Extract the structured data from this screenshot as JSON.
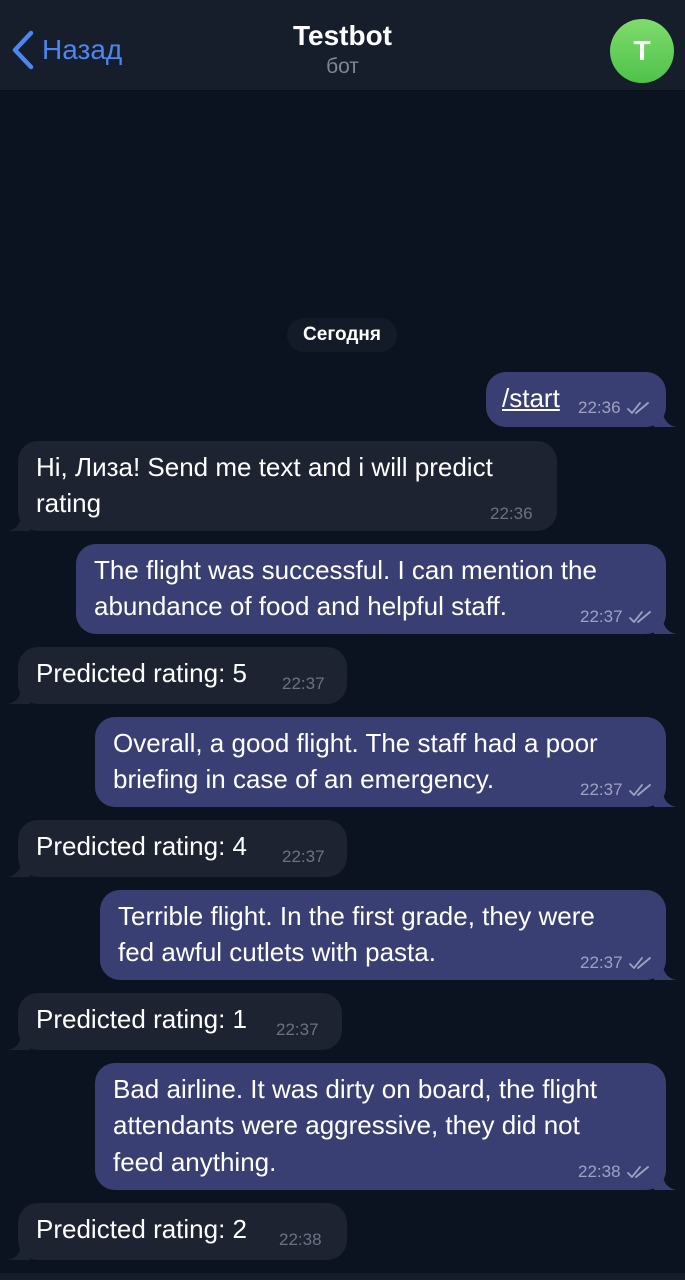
{
  "header": {
    "back_label": "Назад",
    "title": "Testbot",
    "subtitle": "бот",
    "avatar_letter": "T",
    "avatar_color": "#5fcf55"
  },
  "date_separator": "Сегодня",
  "messages": [
    {
      "direction": "out",
      "lines": [
        "/start"
      ],
      "time": "22:36",
      "read": true,
      "command": true
    },
    {
      "direction": "in",
      "lines": [
        "Hi, Лиза! Send me text and i will predict",
        "rating"
      ],
      "time": "22:36"
    },
    {
      "direction": "out",
      "lines": [
        "The flight was successful. I can mention the",
        "abundance of food and helpful staff."
      ],
      "time": "22:37",
      "read": true
    },
    {
      "direction": "in",
      "lines": [
        "Predicted rating: 5"
      ],
      "time": "22:37"
    },
    {
      "direction": "out",
      "lines": [
        "Overall, a good flight. The staff had a poor",
        "briefing in case of an emergency."
      ],
      "time": "22:37",
      "read": true
    },
    {
      "direction": "in",
      "lines": [
        "Predicted rating: 4"
      ],
      "time": "22:37"
    },
    {
      "direction": "out",
      "lines": [
        "Terrible flight. In the first grade, they were",
        "fed awful cutlets with pasta."
      ],
      "time": "22:37",
      "read": true
    },
    {
      "direction": "in",
      "lines": [
        "Predicted rating: 1"
      ],
      "time": "22:37"
    },
    {
      "direction": "out",
      "lines": [
        "Bad airline. It was dirty on board, the flight",
        "attendants were aggressive, they did not",
        "feed anything."
      ],
      "time": "22:38",
      "read": true
    },
    {
      "direction": "in",
      "lines": [
        "Predicted rating: 2"
      ],
      "time": "22:38"
    }
  ],
  "colors": {
    "background": "#0c1320",
    "header": "#161d2b",
    "outgoing_bubble": "#3a3f73",
    "incoming_bubble": "#1e2331",
    "accent": "#4d86f0"
  }
}
